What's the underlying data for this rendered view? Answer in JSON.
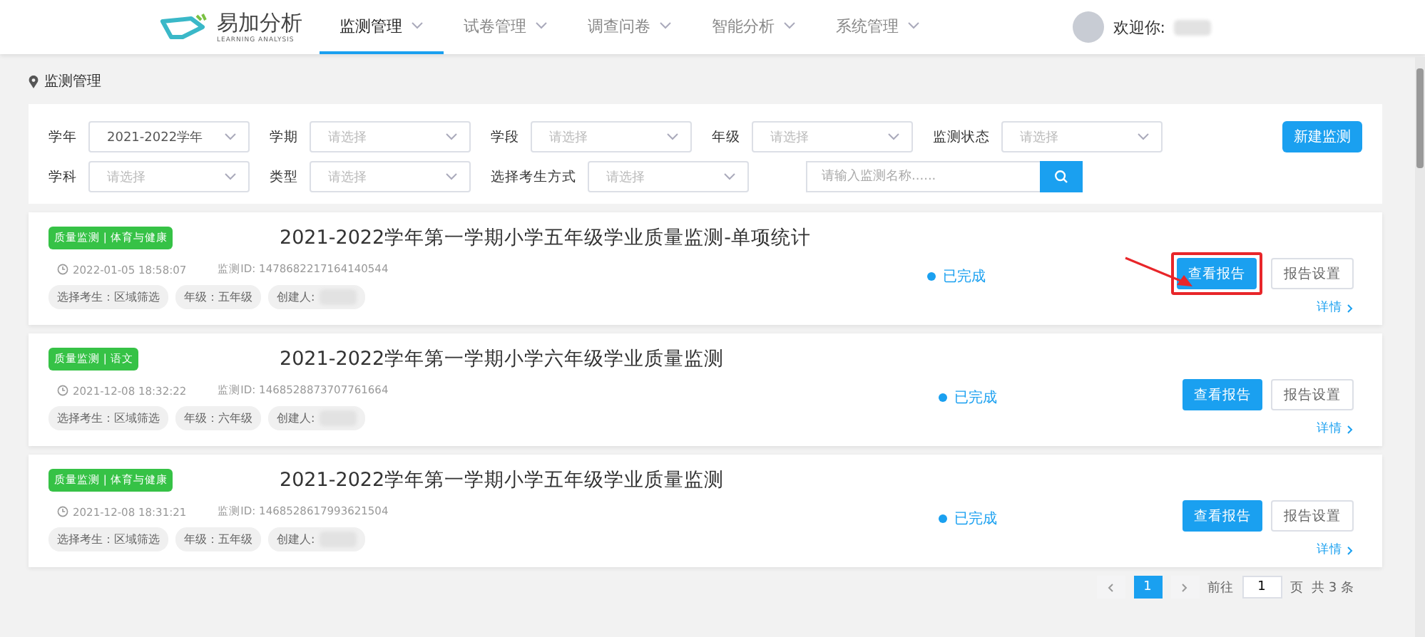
{
  "header": {
    "logo_text": "易加分析",
    "logo_subtitle": "LEARNING ANALYSIS",
    "nav": [
      {
        "label": "监测管理",
        "selected": true
      },
      {
        "label": "试卷管理",
        "selected": false
      },
      {
        "label": "调查问卷",
        "selected": false
      },
      {
        "label": "智能分析",
        "selected": false
      },
      {
        "label": "系统管理",
        "selected": false
      }
    ],
    "welcome": "欢迎你:"
  },
  "breadcrumb": "监测管理",
  "filters": {
    "rows": [
      [
        {
          "label": "学年",
          "value": "2021-2022学年"
        },
        {
          "label": "学期",
          "placeholder": "请选择"
        },
        {
          "label": "学段",
          "placeholder": "请选择"
        },
        {
          "label": "年级",
          "placeholder": "请选择"
        },
        {
          "label": "监测状态",
          "placeholder": "请选择"
        }
      ],
      [
        {
          "label": "学科",
          "placeholder": "请选择"
        },
        {
          "label": "类型",
          "placeholder": "请选择"
        },
        {
          "label": "选择考生方式",
          "placeholder": "请选择"
        }
      ]
    ],
    "search": {
      "placeholder": "请输入监测名称......"
    },
    "new_button": "新建监测"
  },
  "monitors": [
    {
      "tag": "质量监测 | 体育与健康",
      "title": "2021-2022学年第一学期小学五年级学业质量监测-单项统计",
      "time": "2022-01-05 18:58:07",
      "id": "监测ID: 1478682217164140544",
      "chips": [
        "选择考生：区域筛选",
        "年级：五年级",
        "创建人:"
      ],
      "status": "已完成",
      "view_button": "查看报告",
      "settings_button": "报告设置",
      "details": "详情",
      "highlighted": true
    },
    {
      "tag": "质量监测 | 语文",
      "title": "2021-2022学年第一学期小学六年级学业质量监测",
      "time": "2021-12-08 18:32:22",
      "id": "监测ID: 1468528873707761664",
      "chips": [
        "选择考生：区域筛选",
        "年级：六年级",
        "创建人:"
      ],
      "status": "已完成",
      "view_button": "查看报告",
      "settings_button": "报告设置",
      "details": "详情",
      "highlighted": false
    },
    {
      "tag": "质量监测 | 体育与健康",
      "title": "2021-2022学年第一学期小学五年级学业质量监测",
      "time": "2021-12-08 18:31:21",
      "id": "监测ID: 1468528617993621504",
      "chips": [
        "选择考生：区域筛选",
        "年级：五年级",
        "创建人:"
      ],
      "status": "已完成",
      "view_button": "查看报告",
      "settings_button": "报告设置",
      "details": "详情",
      "highlighted": false
    }
  ],
  "pagination": {
    "pages": [
      {
        "label": "1",
        "selected": true
      }
    ],
    "goto": "前往",
    "goto_value": "1",
    "page_unit": "页",
    "total": "共 3 条"
  }
}
